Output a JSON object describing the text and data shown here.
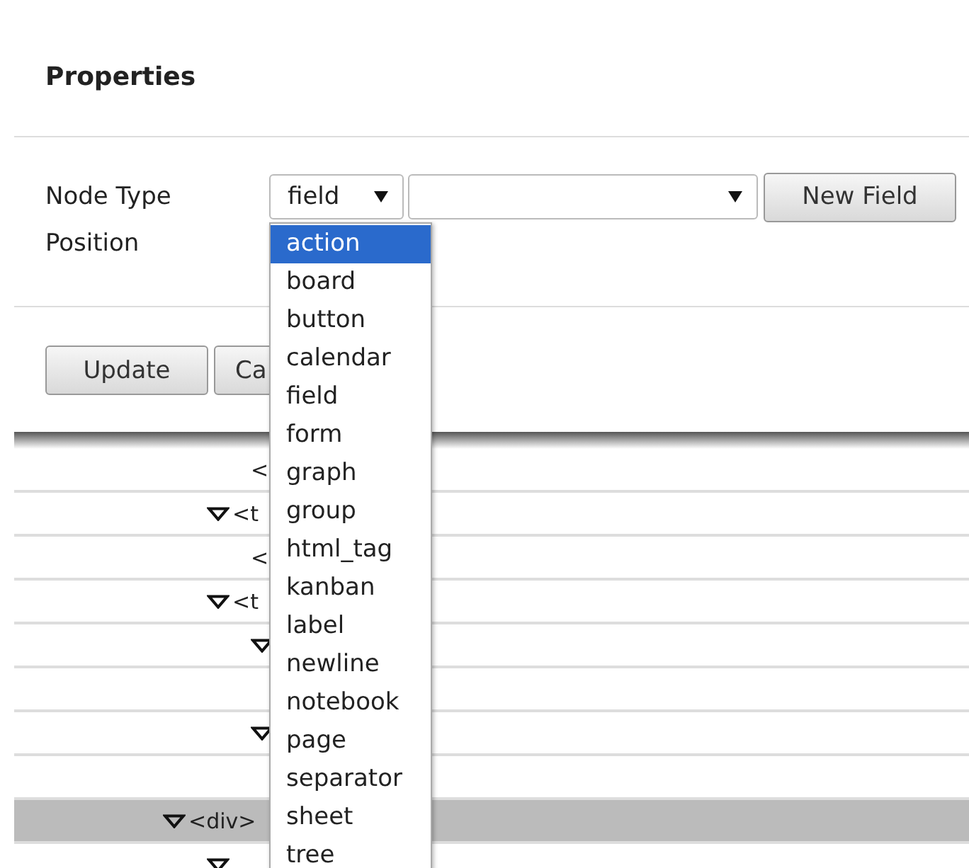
{
  "dialog": {
    "title": "Properties",
    "fields": [
      {
        "label": "Node Type",
        "kind": "selects"
      },
      {
        "label": "Position",
        "kind": "empty"
      }
    ],
    "node_type_select": {
      "value": "field"
    },
    "new_button": "New Field",
    "buttons": [
      "Update",
      "Ca"
    ]
  },
  "dropdown": {
    "options": [
      {
        "label": "action",
        "selected": true
      },
      {
        "label": "board",
        "selected": false
      },
      {
        "label": "button",
        "selected": false
      },
      {
        "label": "calendar",
        "selected": false
      },
      {
        "label": "field",
        "selected": false
      },
      {
        "label": "form",
        "selected": false
      },
      {
        "label": "graph",
        "selected": false
      },
      {
        "label": "group",
        "selected": false
      },
      {
        "label": "html_tag",
        "selected": false
      },
      {
        "label": "kanban",
        "selected": false
      },
      {
        "label": "label",
        "selected": false
      },
      {
        "label": "newline",
        "selected": false
      },
      {
        "label": "notebook",
        "selected": false
      },
      {
        "label": "page",
        "selected": false
      },
      {
        "label": "separator",
        "selected": false
      },
      {
        "label": "sheet",
        "selected": false
      },
      {
        "label": "tree",
        "selected": false
      }
    ]
  },
  "tree": [
    {
      "children": [
        {
          "children": [
            {
              "kind": "node",
              "text": "<",
              "selected": false
            }
          ]
        },
        {
          "kind": "node",
          "text": "<t",
          "expanded": true,
          "selected": false,
          "children": [
            {
              "kind": "node",
              "text": "<",
              "selected": false
            }
          ]
        },
        {
          "kind": "node",
          "text": "<t",
          "expanded": true,
          "selected": false,
          "children": [
            {
              "kind": "node",
              "expanded": true,
              "selected": false,
              "children": [
                {
                  "kind": "node",
                  "selected": false
                }
              ]
            },
            {
              "kind": "node",
              "expanded": true,
              "selected": false,
              "children": [
                {
                  "kind": "node",
                  "selected": false
                }
              ]
            }
          ]
        }
      ]
    },
    {
      "kind": "node",
      "text": "<div>",
      "expanded": true,
      "selected": true,
      "children": [
        {
          "kind": "node",
          "expanded": true,
          "selected": false
        }
      ]
    }
  ]
}
